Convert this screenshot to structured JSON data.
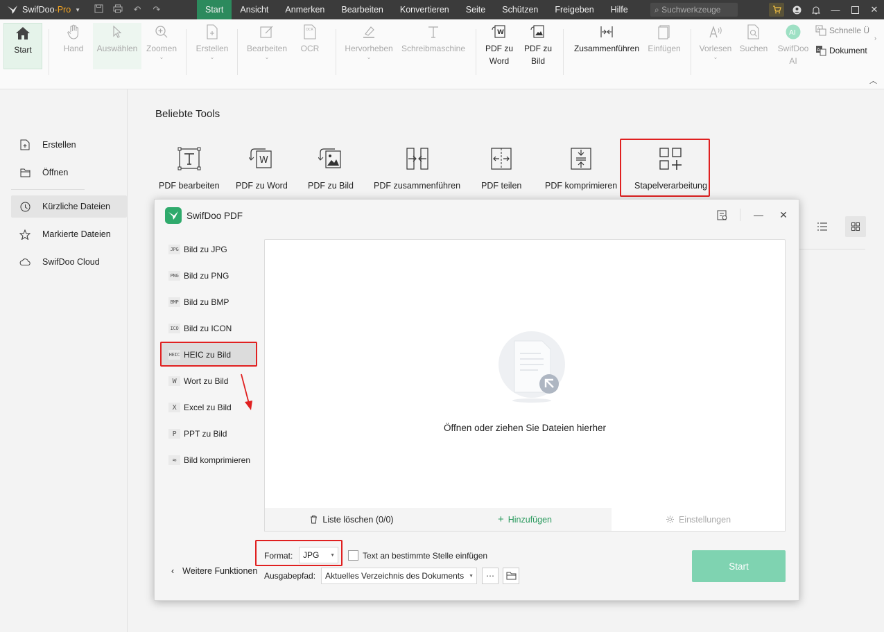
{
  "titlebar": {
    "brand": "SwifDoo",
    "brand_pro": "-Pro",
    "menu": [
      "Start",
      "Ansicht",
      "Anmerken",
      "Bearbeiten",
      "Konvertieren",
      "Seite",
      "Schützen",
      "Freigeben",
      "Hilfe"
    ],
    "active_menu": "Start",
    "search_placeholder": "Suchwerkzeuge"
  },
  "ribbon": {
    "start": "Start",
    "hand": "Hand",
    "auswaehlen": "Auswählen",
    "zoomen": "Zoomen",
    "erstellen": "Erstellen",
    "bearbeiten": "Bearbeiten",
    "ocr": "OCR",
    "hervorheben": "Hervorheben",
    "schreibmaschine": "Schreibmaschine",
    "pdf_zu_word_1": "PDF zu",
    "pdf_zu_word_2": "Word",
    "pdf_zu_bild_1": "PDF zu",
    "pdf_zu_bild_2": "Bild",
    "zusammenfuehren": "Zusammenführen",
    "einfuegen": "Einfügen",
    "vorlesen": "Vorlesen",
    "suchen": "Suchen",
    "swifdoo_ai_1": "SwifDoo",
    "swifdoo_ai_2": "AI",
    "schnelle": "Schnelle Ü",
    "dokument": "Dokument"
  },
  "leftnav": {
    "items": [
      "Erstellen",
      "Öffnen",
      "Kürzliche Dateien",
      "Markierte Dateien",
      "SwifDoo Cloud"
    ],
    "active": "Kürzliche Dateien"
  },
  "main": {
    "section_title": "Beliebte Tools",
    "tools": [
      "PDF bearbeiten",
      "PDF zu Word",
      "PDF zu Bild",
      "PDF zusammenführen",
      "PDF teilen",
      "PDF komprimieren",
      "Stapelverarbeitung"
    ]
  },
  "dialog": {
    "title": "SwifDoo PDF",
    "items": [
      {
        "badge": "JPG",
        "label": "Bild zu JPG"
      },
      {
        "badge": "PNG",
        "label": "Bild zu PNG"
      },
      {
        "badge": "BMP",
        "label": "Bild zu BMP"
      },
      {
        "badge": "ICO",
        "label": "Bild zu ICON"
      },
      {
        "badge": "HEIC",
        "label": "HEIC zu Bild"
      },
      {
        "badge": "W",
        "label": "Wort zu Bild"
      },
      {
        "badge": "X",
        "label": "Excel zu Bild"
      },
      {
        "badge": "P",
        "label": "PPT zu Bild"
      },
      {
        "badge": "≈",
        "label": "Bild komprimieren"
      }
    ],
    "active_item": "HEIC zu Bild",
    "drop_text": "Öffnen oder ziehen Sie Dateien hierher",
    "clear_list": "Liste löschen (0/0)",
    "add": "Hinzufügen",
    "settings": "Einstellungen",
    "format_label": "Format:",
    "format_value": "JPG",
    "insert_text": "Text an bestimmte Stelle einfügen",
    "output_label": "Ausgabepfad:",
    "output_value": "Aktuelles Verzeichnis des Dokuments",
    "more": "Weitere Funktionen",
    "start": "Start"
  },
  "colors": {
    "accent": "#2c8a5d",
    "start_button": "#7fd3b1",
    "highlight_box": "#e02020"
  }
}
